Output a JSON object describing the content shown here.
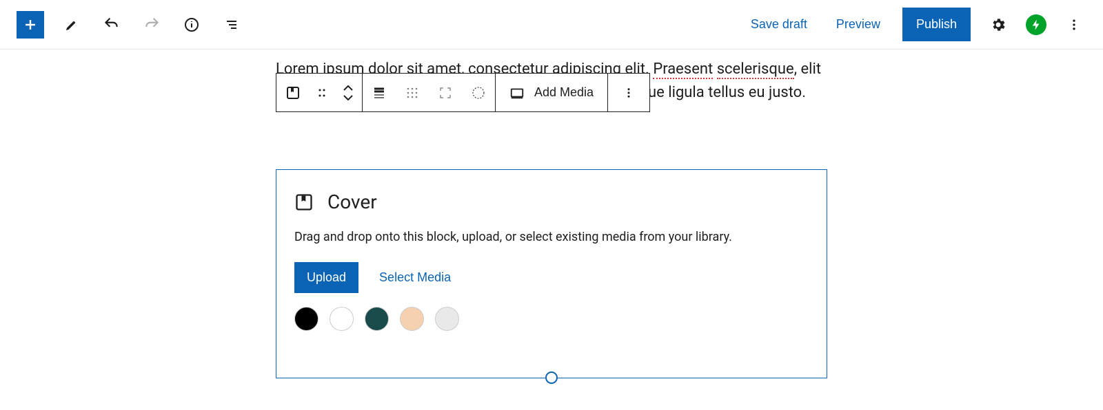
{
  "header": {
    "save_draft": "Save draft",
    "preview": "Preview",
    "publish": "Publish"
  },
  "paragraph": {
    "part1": "Lorem ipsum dolor sit amet, consectetur adipiscing elit. ",
    "misspelled1": "Praesent",
    "part2": " ",
    "misspelled2": "scelerisque",
    "part3": ", elit",
    "part4": "ue ligula tellus eu justo."
  },
  "block_toolbar": {
    "add_media": "Add Media"
  },
  "cover": {
    "title": "Cover",
    "description": "Drag and drop onto this block, upload, or select existing media from your library.",
    "upload": "Upload",
    "select_media": "Select Media",
    "swatches": [
      {
        "name": "Black",
        "color": "#000000"
      },
      {
        "name": "White",
        "color": "#ffffff"
      },
      {
        "name": "Dark Teal",
        "color": "#1a4b4b"
      },
      {
        "name": "Peach",
        "color": "#f6d1b0"
      },
      {
        "name": "Light Gray",
        "color": "#e9e9e9"
      }
    ]
  }
}
